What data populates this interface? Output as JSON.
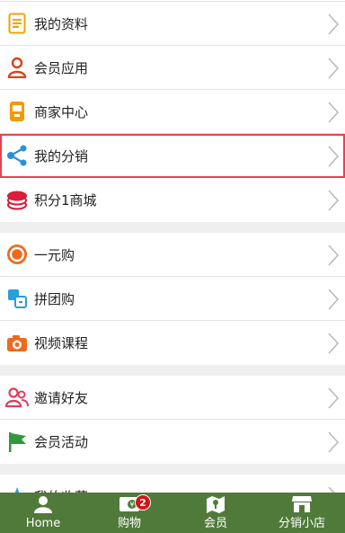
{
  "sections": [
    {
      "items": [
        {
          "label": "我的资料",
          "icon": "profile-doc-icon",
          "selected": false
        },
        {
          "label": "会员应用",
          "icon": "member-user-icon",
          "selected": false
        },
        {
          "label": "商家中心",
          "icon": "merchant-icon",
          "selected": false
        },
        {
          "label": "我的分销",
          "icon": "share-icon",
          "selected": true
        },
        {
          "label": "积分1商城",
          "icon": "points-coins-icon",
          "selected": false
        }
      ]
    },
    {
      "items": [
        {
          "label": "一元购",
          "icon": "one-yuan-circle-icon",
          "selected": false
        },
        {
          "label": "拼团购",
          "icon": "group-buy-icon",
          "selected": false
        },
        {
          "label": "视频课程",
          "icon": "camera-icon",
          "selected": false
        }
      ]
    },
    {
      "items": [
        {
          "label": "邀请好友",
          "icon": "invite-friends-icon",
          "selected": false
        },
        {
          "label": "会员活动",
          "icon": "flag-icon",
          "selected": false
        }
      ]
    },
    {
      "items": [
        {
          "label": "我的收藏",
          "icon": "star-icon",
          "selected": false
        }
      ]
    }
  ],
  "tabbar": {
    "background": "#507a3a",
    "tabs": [
      {
        "label": "Home",
        "icon": "home-person-icon"
      },
      {
        "label": "购物",
        "icon": "cart-icon",
        "badge": "2"
      },
      {
        "label": "会员",
        "icon": "member-map-icon"
      },
      {
        "label": "分销小店",
        "icon": "shop-icon"
      }
    ]
  },
  "colors": {
    "selected_outline": "#e4424f",
    "badge": "#d0141b"
  }
}
